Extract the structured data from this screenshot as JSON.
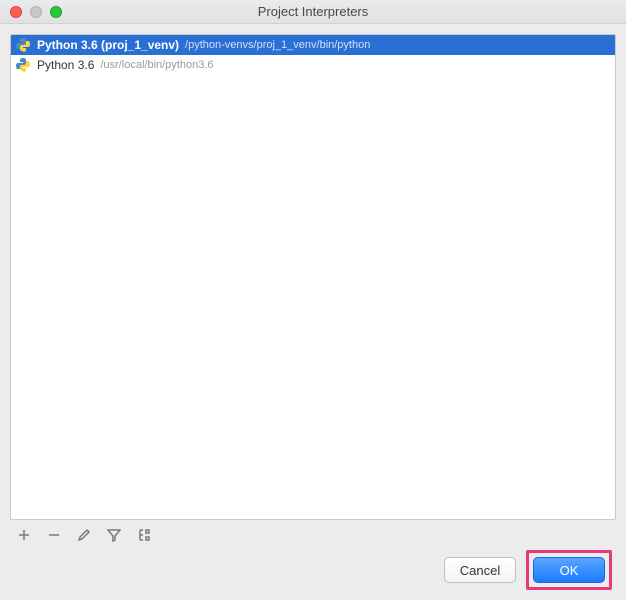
{
  "window": {
    "title": "Project Interpreters"
  },
  "interpreters": [
    {
      "name": "Python 3.6 (proj_1_venv)",
      "path": "/python-venvs/proj_1_venv/bin/python",
      "selected": true
    },
    {
      "name": "Python 3.6",
      "path": "/usr/local/bin/python3.6",
      "selected": false
    }
  ],
  "buttons": {
    "cancel": "Cancel",
    "ok": "OK"
  }
}
